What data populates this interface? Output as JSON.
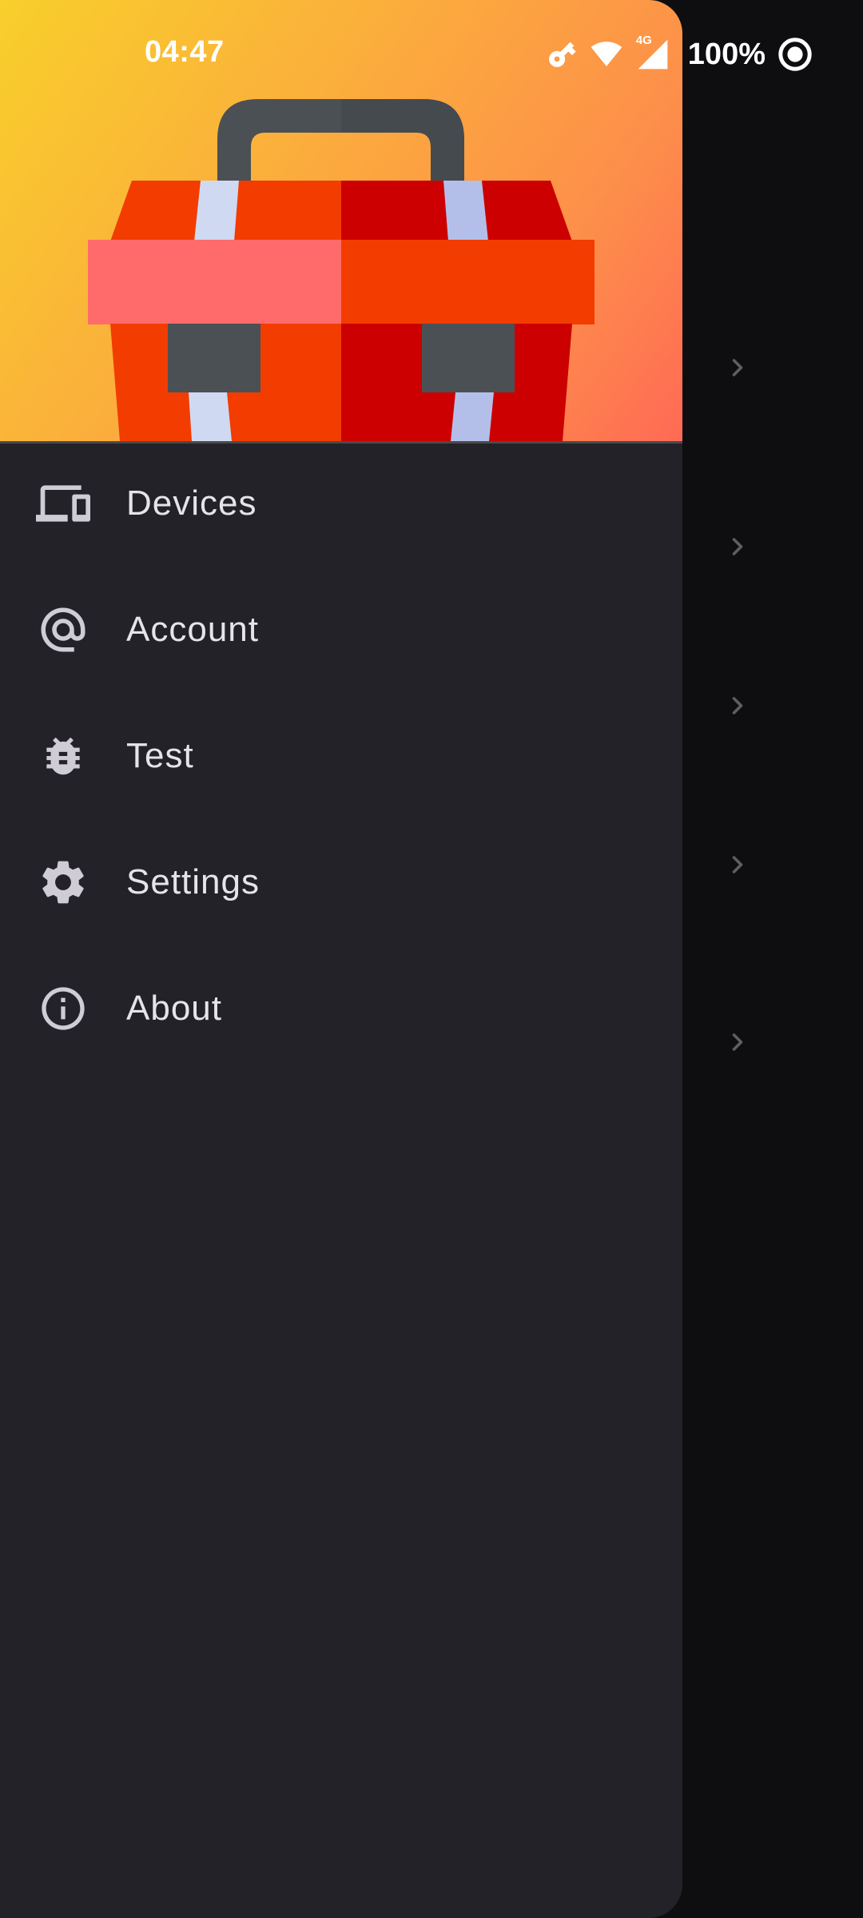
{
  "status_bar": {
    "time": "04:47",
    "battery": "100%",
    "icons": [
      "key-icon",
      "wifi-icon",
      "signal-4g-icon",
      "ring-icon"
    ],
    "network_label": "4G"
  },
  "drawer": {
    "header_image": "toolbox-illustration",
    "items": [
      {
        "label": "Devices",
        "icon": "devices-icon"
      },
      {
        "label": "Account",
        "icon": "at-sign-icon"
      },
      {
        "label": "Test",
        "icon": "bug-icon"
      },
      {
        "label": "Settings",
        "icon": "gear-icon"
      },
      {
        "label": "About",
        "icon": "info-icon"
      }
    ]
  },
  "background": {
    "chevron_count": 5,
    "chevron_icon": "chevron-right-icon"
  },
  "colors": {
    "drawer_bg": "#232228",
    "scrim": "#0e0e11",
    "text": "#e6e4ea",
    "icon": "#cfccd6",
    "header_gradient_start": "#f8cf2b",
    "header_gradient_end": "#ff6a55"
  }
}
